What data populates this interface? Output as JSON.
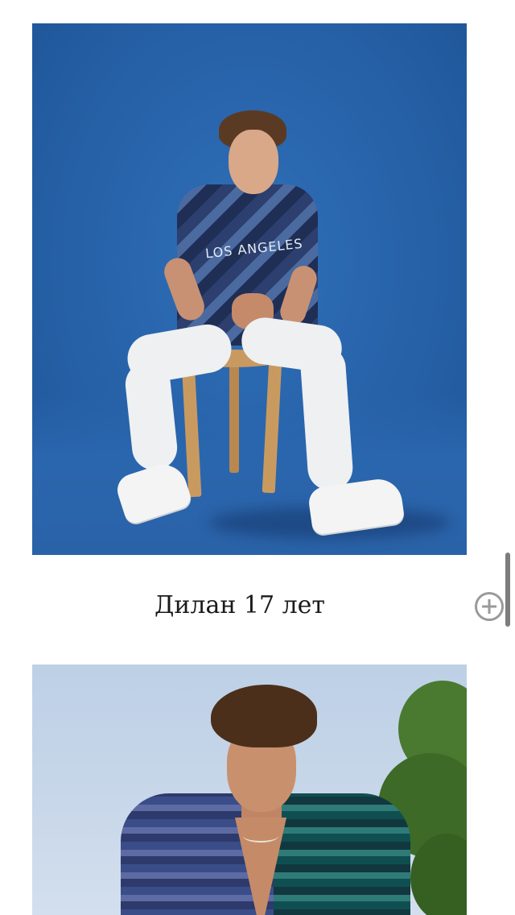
{
  "gallery": {
    "items": [
      {
        "photo_label": "photo-dylan",
        "caption": "Дилан 17 лет",
        "shirt_print": "LOS ANGELES"
      },
      {
        "photo_label": "photo-second-boy"
      }
    ]
  },
  "colors": {
    "backdrop_blue": "#2864ab",
    "page_background": "#ffffff",
    "caption_text": "#1a1a1a",
    "add_icon": "#9a9a9a"
  },
  "icons": {
    "add": "plus-circle-icon"
  }
}
